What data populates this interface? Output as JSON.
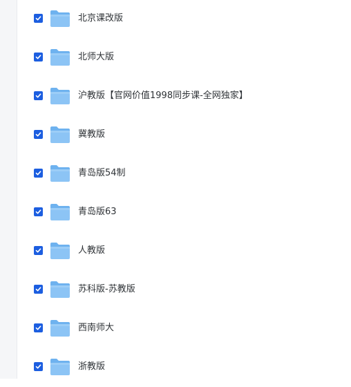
{
  "file_list": {
    "items": [
      {
        "name": "北京课改版",
        "checked": true,
        "icon": "folder-icon"
      },
      {
        "name": "北师大版",
        "checked": true,
        "icon": "folder-icon"
      },
      {
        "name": "沪教版【官网价值1998同步课-全网独家】",
        "checked": true,
        "icon": "folder-icon"
      },
      {
        "name": "冀教版",
        "checked": true,
        "icon": "folder-icon"
      },
      {
        "name": "青岛版54制",
        "checked": true,
        "icon": "folder-icon"
      },
      {
        "name": "青岛版63",
        "checked": true,
        "icon": "folder-icon"
      },
      {
        "name": "人教版",
        "checked": true,
        "icon": "folder-icon"
      },
      {
        "name": "苏科版-苏教版",
        "checked": true,
        "icon": "folder-icon"
      },
      {
        "name": "西南师大",
        "checked": true,
        "icon": "folder-icon"
      },
      {
        "name": "浙教版",
        "checked": true,
        "icon": "folder-icon"
      }
    ]
  },
  "colors": {
    "checkbox": "#1c5ee0",
    "folder_body": "#8cc4f5",
    "folder_tab": "#6eb2ef",
    "text": "#2f3337"
  }
}
